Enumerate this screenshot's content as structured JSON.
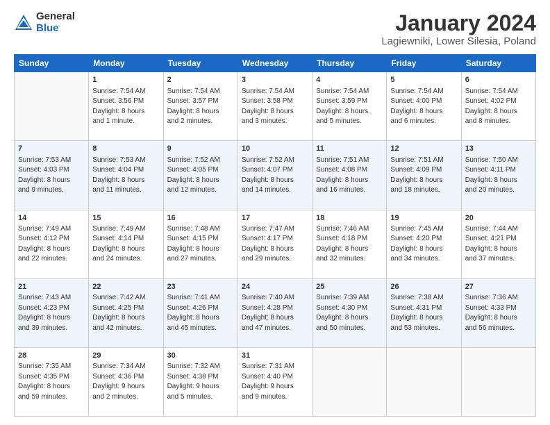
{
  "logo": {
    "general": "General",
    "blue": "Blue"
  },
  "title": "January 2024",
  "location": "Lagiewniki, Lower Silesia, Poland",
  "days_header": [
    "Sunday",
    "Monday",
    "Tuesday",
    "Wednesday",
    "Thursday",
    "Friday",
    "Saturday"
  ],
  "weeks": [
    [
      {
        "day": "",
        "info": ""
      },
      {
        "day": "1",
        "info": "Sunrise: 7:54 AM\nSunset: 3:56 PM\nDaylight: 8 hours\nand 1 minute."
      },
      {
        "day": "2",
        "info": "Sunrise: 7:54 AM\nSunset: 3:57 PM\nDaylight: 8 hours\nand 2 minutes."
      },
      {
        "day": "3",
        "info": "Sunrise: 7:54 AM\nSunset: 3:58 PM\nDaylight: 8 hours\nand 3 minutes."
      },
      {
        "day": "4",
        "info": "Sunrise: 7:54 AM\nSunset: 3:59 PM\nDaylight: 8 hours\nand 5 minutes."
      },
      {
        "day": "5",
        "info": "Sunrise: 7:54 AM\nSunset: 4:00 PM\nDaylight: 8 hours\nand 6 minutes."
      },
      {
        "day": "6",
        "info": "Sunrise: 7:54 AM\nSunset: 4:02 PM\nDaylight: 8 hours\nand 8 minutes."
      }
    ],
    [
      {
        "day": "7",
        "info": "Sunrise: 7:53 AM\nSunset: 4:03 PM\nDaylight: 8 hours\nand 9 minutes."
      },
      {
        "day": "8",
        "info": "Sunrise: 7:53 AM\nSunset: 4:04 PM\nDaylight: 8 hours\nand 11 minutes."
      },
      {
        "day": "9",
        "info": "Sunrise: 7:52 AM\nSunset: 4:05 PM\nDaylight: 8 hours\nand 12 minutes."
      },
      {
        "day": "10",
        "info": "Sunrise: 7:52 AM\nSunset: 4:07 PM\nDaylight: 8 hours\nand 14 minutes."
      },
      {
        "day": "11",
        "info": "Sunrise: 7:51 AM\nSunset: 4:08 PM\nDaylight: 8 hours\nand 16 minutes."
      },
      {
        "day": "12",
        "info": "Sunrise: 7:51 AM\nSunset: 4:09 PM\nDaylight: 8 hours\nand 18 minutes."
      },
      {
        "day": "13",
        "info": "Sunrise: 7:50 AM\nSunset: 4:11 PM\nDaylight: 8 hours\nand 20 minutes."
      }
    ],
    [
      {
        "day": "14",
        "info": "Sunrise: 7:49 AM\nSunset: 4:12 PM\nDaylight: 8 hours\nand 22 minutes."
      },
      {
        "day": "15",
        "info": "Sunrise: 7:49 AM\nSunset: 4:14 PM\nDaylight: 8 hours\nand 24 minutes."
      },
      {
        "day": "16",
        "info": "Sunrise: 7:48 AM\nSunset: 4:15 PM\nDaylight: 8 hours\nand 27 minutes."
      },
      {
        "day": "17",
        "info": "Sunrise: 7:47 AM\nSunset: 4:17 PM\nDaylight: 8 hours\nand 29 minutes."
      },
      {
        "day": "18",
        "info": "Sunrise: 7:46 AM\nSunset: 4:18 PM\nDaylight: 8 hours\nand 32 minutes."
      },
      {
        "day": "19",
        "info": "Sunrise: 7:45 AM\nSunset: 4:20 PM\nDaylight: 8 hours\nand 34 minutes."
      },
      {
        "day": "20",
        "info": "Sunrise: 7:44 AM\nSunset: 4:21 PM\nDaylight: 8 hours\nand 37 minutes."
      }
    ],
    [
      {
        "day": "21",
        "info": "Sunrise: 7:43 AM\nSunset: 4:23 PM\nDaylight: 8 hours\nand 39 minutes."
      },
      {
        "day": "22",
        "info": "Sunrise: 7:42 AM\nSunset: 4:25 PM\nDaylight: 8 hours\nand 42 minutes."
      },
      {
        "day": "23",
        "info": "Sunrise: 7:41 AM\nSunset: 4:26 PM\nDaylight: 8 hours\nand 45 minutes."
      },
      {
        "day": "24",
        "info": "Sunrise: 7:40 AM\nSunset: 4:28 PM\nDaylight: 8 hours\nand 47 minutes."
      },
      {
        "day": "25",
        "info": "Sunrise: 7:39 AM\nSunset: 4:30 PM\nDaylight: 8 hours\nand 50 minutes."
      },
      {
        "day": "26",
        "info": "Sunrise: 7:38 AM\nSunset: 4:31 PM\nDaylight: 8 hours\nand 53 minutes."
      },
      {
        "day": "27",
        "info": "Sunrise: 7:36 AM\nSunset: 4:33 PM\nDaylight: 8 hours\nand 56 minutes."
      }
    ],
    [
      {
        "day": "28",
        "info": "Sunrise: 7:35 AM\nSunset: 4:35 PM\nDaylight: 8 hours\nand 59 minutes."
      },
      {
        "day": "29",
        "info": "Sunrise: 7:34 AM\nSunset: 4:36 PM\nDaylight: 9 hours\nand 2 minutes."
      },
      {
        "day": "30",
        "info": "Sunrise: 7:32 AM\nSunset: 4:38 PM\nDaylight: 9 hours\nand 5 minutes."
      },
      {
        "day": "31",
        "info": "Sunrise: 7:31 AM\nSunset: 4:40 PM\nDaylight: 9 hours\nand 9 minutes."
      },
      {
        "day": "",
        "info": ""
      },
      {
        "day": "",
        "info": ""
      },
      {
        "day": "",
        "info": ""
      }
    ]
  ]
}
